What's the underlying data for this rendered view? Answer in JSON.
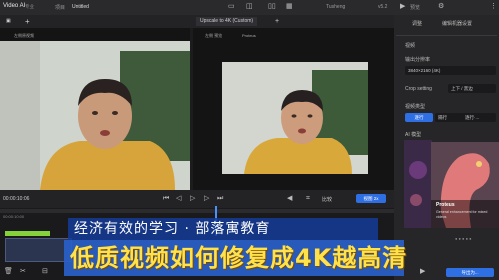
{
  "app": {
    "name": "Video AI",
    "badge": "专业",
    "menu": [
      "项目",
      "Untitled"
    ],
    "right_menu": [
      "Tusheng",
      "v5.2"
    ]
  },
  "tabs": {
    "upscale": "Upscale to 4K (Custom)",
    "add": "+"
  },
  "left_view": {
    "label": "左侧原视频"
  },
  "right_view": {
    "label": "左侧 预览",
    "model": "Proteus"
  },
  "sidebar": {
    "tabs": [
      "调整",
      "编辑机器设置"
    ],
    "section": "视频",
    "resolution_label": "输出分辨率",
    "resolution_value": "3840×2160 (4K)",
    "crop_label": "Crop setting",
    "crop_value": "上下 / 黑边",
    "video_type_label": "视频类型",
    "video_type_options": [
      "逐行",
      "隔行",
      "逐行·..."
    ],
    "ai_label": "AI 模型",
    "model_name": "Proteus",
    "model_desc": "General enhancement for mixed videos",
    "export_label": "导出为..."
  },
  "toolbar": {
    "timecode": "00:00:10:06",
    "compare_label": "比较",
    "zoom_label": "视图 2x"
  },
  "timeline": {
    "time": "00:00:10:00"
  },
  "banner": {
    "line1": "经济有效的学习 · 部落寓教育",
    "line2": "低质视频如何修复成4K越高清"
  }
}
